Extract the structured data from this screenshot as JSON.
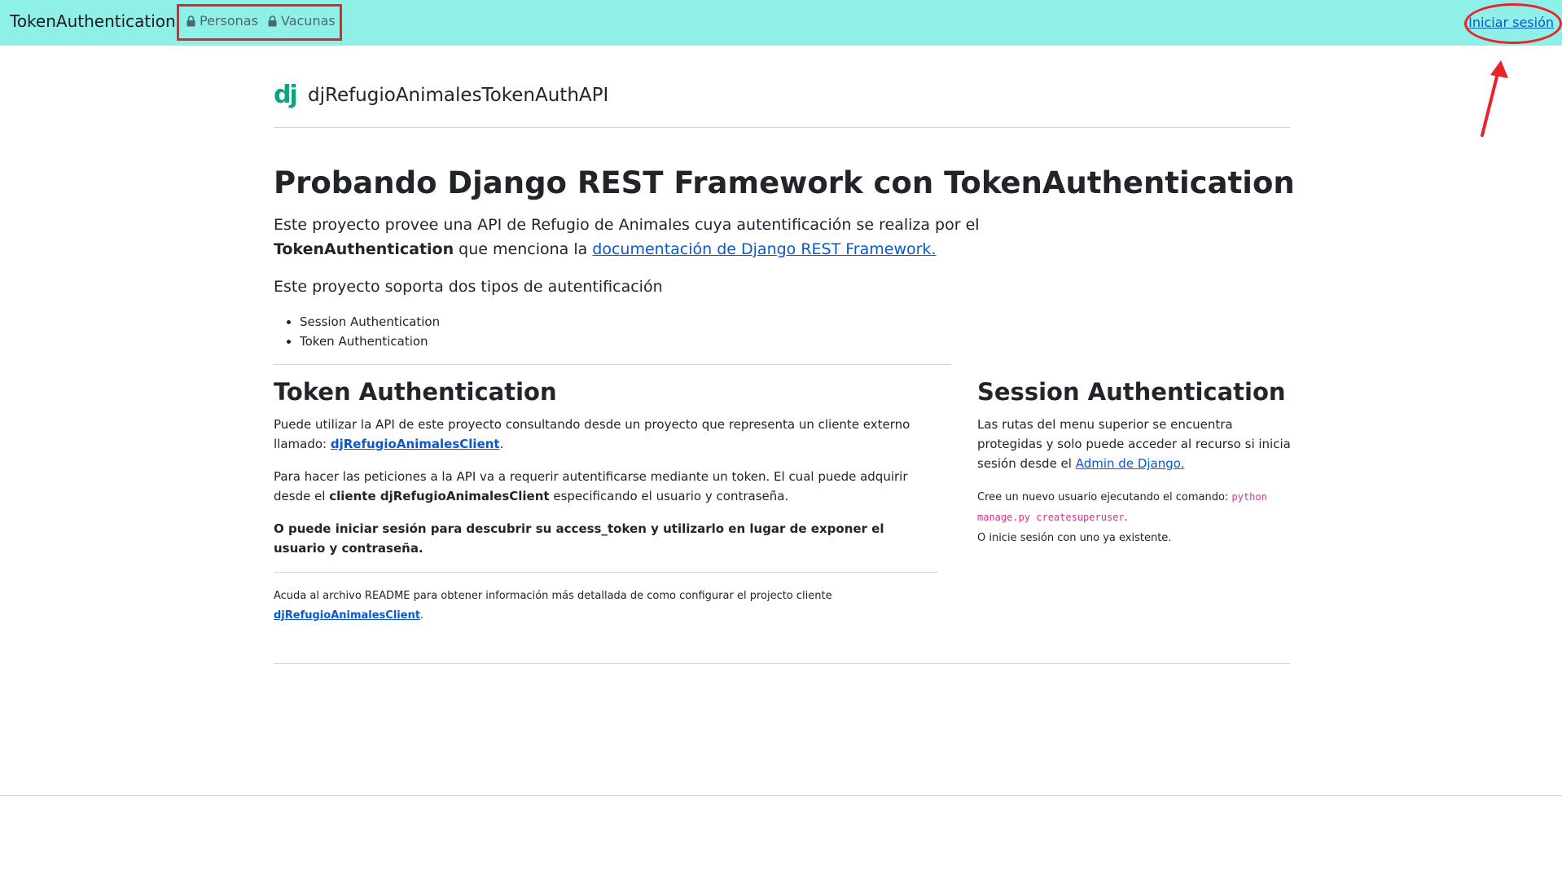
{
  "navbar": {
    "brand": "TokenAuthentication",
    "links": [
      {
        "label": "Personas",
        "icon": "lock-icon"
      },
      {
        "label": "Vacunas",
        "icon": "lock-icon"
      }
    ],
    "login_label": "Iniciar sesión",
    "background": "#8ff0e8"
  },
  "header": {
    "logo_text": "dj",
    "site_title": "djRefugioAnimalesTokenAuthAPI"
  },
  "intro": {
    "title": "Probando Django REST Framework con TokenAuthentication",
    "lead_part1": "Este proyecto provee una API de Refugio de Animales cuya autentificación se realiza por el ",
    "lead_bold": "TokenAuthentication",
    "lead_part2": " que menciona la ",
    "lead_link": "documentación de Django REST Framework.",
    "lead2": "Este proyecto soporta dos tipos de autentificación",
    "types": [
      "Session Authentication",
      "Token Authentication"
    ]
  },
  "token_section": {
    "title": "Token Authentication",
    "p1_text": "Puede utilizar la API de este proyecto consultando desde un proyecto que representa un cliente externo llamado: ",
    "p1_link": "djRefugioAnimalesClient",
    "p1_end": ".",
    "p2_text": "Para hacer las peticiones a la API va a requerir autentificarse mediante un token. El cual puede adquirir desde el ",
    "p2_bold": "cliente djRefugioAnimalesClient",
    "p2_end": " especificando el usuario y contraseña.",
    "p3": "O puede iniciar sesión para descubrir su access_token y utilizarlo en lugar de exponer el usuario y contraseña.",
    "note_text": "Acuda al archivo README para obtener información más detallada de como configurar el projecto cliente ",
    "note_link": "djRefugioAnimalesClient",
    "note_end": "."
  },
  "session_section": {
    "title": "Session Authentication",
    "p1_text": "Las rutas del menu superior se encuentra protegidas y solo puede acceder al recurso si inicia sesión desde el ",
    "p1_link": "Admin de Django.",
    "p2_text": "Cree un nuevo usuario ejecutando el comando: ",
    "p2_code": "python manage.py createsuperuser",
    "p2_end": ".",
    "p3": "O inicie sesión con uno ya existente."
  },
  "colors": {
    "accent": "#0a58ca",
    "annotation": "#e8242a",
    "logo": "#10a37f",
    "code": "#d63384"
  }
}
